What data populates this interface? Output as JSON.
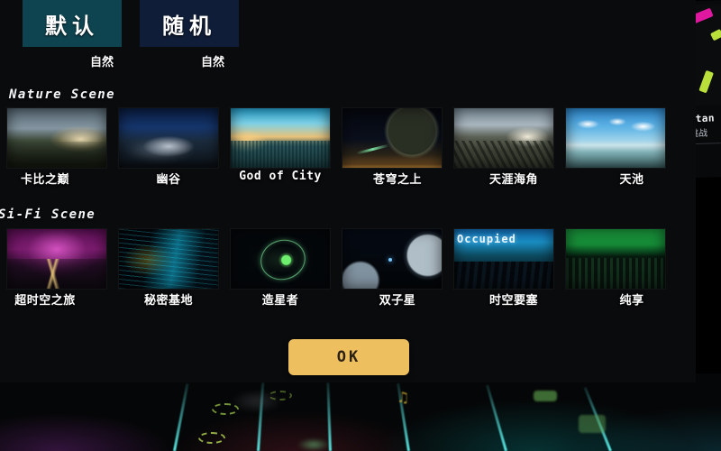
{
  "dialog": {
    "tabs": [
      {
        "label": "默认",
        "sublabel": "自然",
        "state": "active",
        "accent": "#0e4450"
      },
      {
        "label": "随机",
        "sublabel": "自然",
        "state": "inactive",
        "accent": "#101d38"
      }
    ],
    "sections": [
      {
        "title": "Nature Scene",
        "items": [
          {
            "label": "卡比之巅",
            "art": "a-kabi",
            "lang": "zh"
          },
          {
            "label": "幽谷",
            "art": "a-valley",
            "lang": "zh"
          },
          {
            "label": "God of City",
            "art": "a-city",
            "lang": "en"
          },
          {
            "label": "苍穹之上",
            "art": "a-sky",
            "lang": "zh"
          },
          {
            "label": "天涯海角",
            "art": "a-cape",
            "lang": "zh"
          },
          {
            "label": "天池",
            "art": "a-lake",
            "lang": "zh"
          }
        ]
      },
      {
        "title": "Si-Fi Scene",
        "items": [
          {
            "label": "超时空之旅",
            "art": "a-warp",
            "lang": "zh"
          },
          {
            "label": "秘密基地",
            "art": "a-base",
            "lang": "zh"
          },
          {
            "label": "造星者",
            "art": "a-starmaker",
            "lang": "zh"
          },
          {
            "label": "双子星",
            "art": "a-twin",
            "lang": "zh"
          },
          {
            "label": "时空要塞",
            "art": "a-fortress",
            "lang": "zh",
            "badge": "Occupied"
          },
          {
            "label": "纯享",
            "art": "a-pure",
            "lang": "zh"
          }
        ]
      }
    ],
    "confirm_button": {
      "label": "OK",
      "color": "#eebf5f"
    }
  },
  "side_card": {
    "title": "itan",
    "subtitle": "挑战"
  },
  "theme": {
    "panel_bg": "#0a0b0d",
    "text": "#ffffff",
    "tab_active": "#0e4450",
    "tab_inactive": "#101d38",
    "accent_gold": "#eebf5f",
    "lane_cyan": "#5af0eb"
  }
}
